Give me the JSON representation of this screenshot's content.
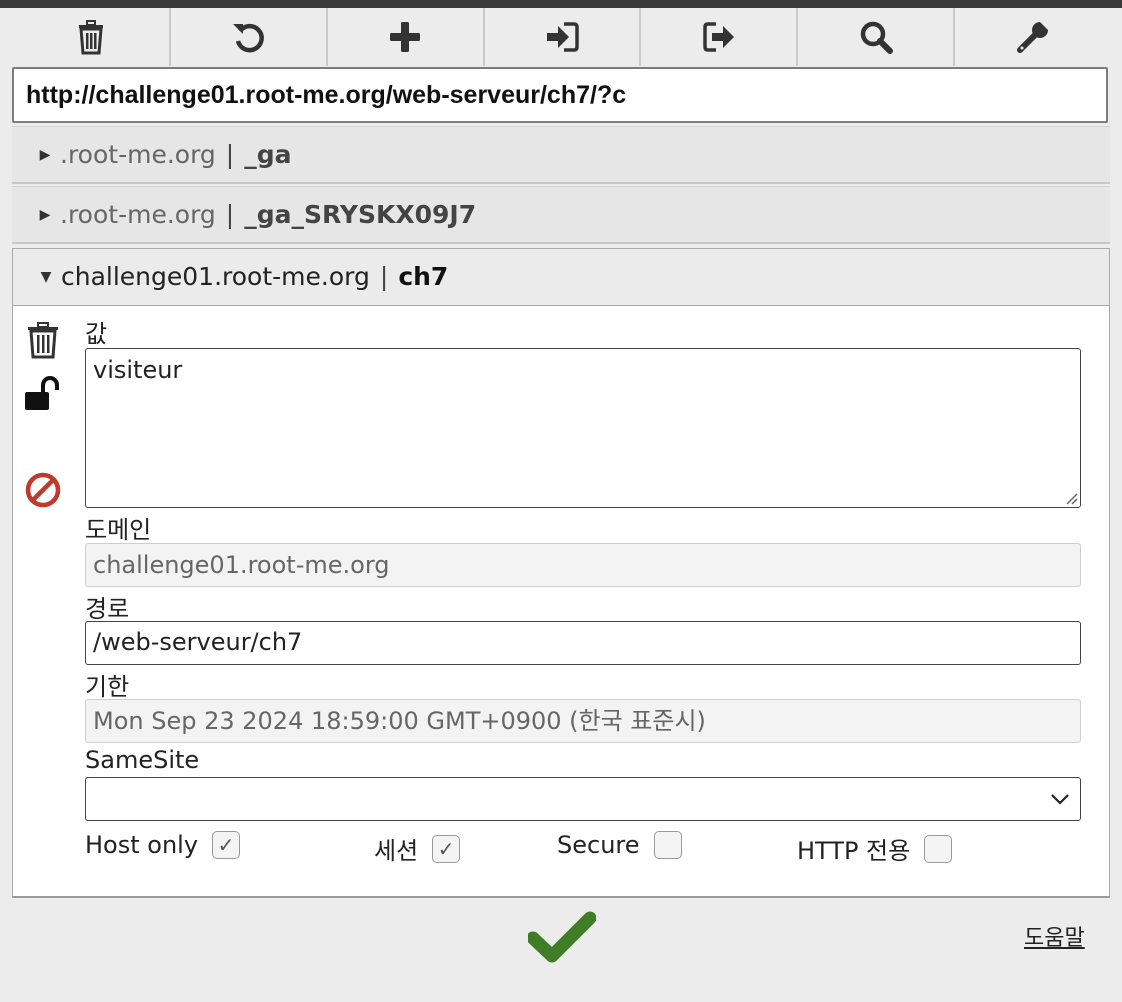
{
  "toolbar": {
    "buttons": [
      {
        "icon": "trash-icon"
      },
      {
        "icon": "refresh-icon"
      },
      {
        "icon": "plus-icon"
      },
      {
        "icon": "import-icon"
      },
      {
        "icon": "export-icon"
      },
      {
        "icon": "search-icon"
      },
      {
        "icon": "wrench-icon"
      }
    ]
  },
  "url": "http://challenge01.root-me.org/web-serveur/ch7/?c",
  "cookies": [
    {
      "domain": ".root-me.org",
      "separator": "|",
      "name": "_ga",
      "expanded": false
    },
    {
      "domain": ".root-me.org",
      "separator": "|",
      "name": "_ga_SRYSKX09J7",
      "expanded": false
    },
    {
      "domain": "challenge01.root-me.org",
      "separator": "|",
      "name": "ch7",
      "expanded": true
    }
  ],
  "detail": {
    "value_label": "값",
    "value": "visiteur",
    "domain_label": "도메인",
    "domain": "challenge01.root-me.org",
    "path_label": "경로",
    "path": "/web-serveur/ch7",
    "expires_label": "기한",
    "expires": "Mon Sep 23 2024 18:59:00 GMT+0900 (한국 표준시)",
    "samesite_label": "SameSite",
    "samesite_value": "",
    "flags": {
      "host_only_label": "Host only",
      "host_only": true,
      "session_label": "세션",
      "session": true,
      "secure_label": "Secure",
      "secure": false,
      "http_only_label": "HTTP 전용",
      "http_only": false
    }
  },
  "footer": {
    "help_label": "도움말"
  },
  "colors": {
    "accept_green": "#3f7e26",
    "block_red": "#c0392b",
    "icon_dark": "#333333"
  }
}
